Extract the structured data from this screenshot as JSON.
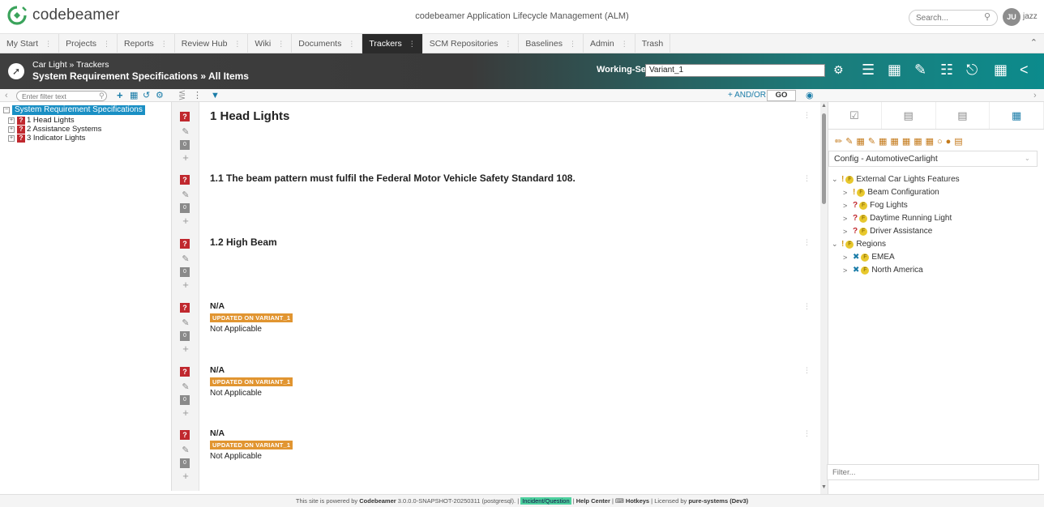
{
  "app": {
    "logo_text": "codebeamer",
    "title": "codebeamer Application Lifecycle Management (ALM)",
    "search_placeholder": "Search...",
    "avatar_initials": "JU",
    "username": "jazz"
  },
  "tabs": [
    {
      "label": "My Start"
    },
    {
      "label": "Projects"
    },
    {
      "label": "Reports"
    },
    {
      "label": "Review Hub"
    },
    {
      "label": "Wiki"
    },
    {
      "label": "Documents"
    },
    {
      "label": "Trackers"
    },
    {
      "label": "SCM Repositories"
    },
    {
      "label": "Baselines"
    },
    {
      "label": "Admin"
    },
    {
      "label": "Trash"
    }
  ],
  "header": {
    "breadcrumb": "Car Light » Trackers",
    "title": "System Requirement Specifications » All Items",
    "working_set_label": "Working-Set:",
    "working_set_value": "Variant_1"
  },
  "toolbar": {
    "filter_placeholder": "Enter filter text",
    "andor_label": "+ AND/OR",
    "go_label": "GO"
  },
  "tree": {
    "root": "System Requirement Specifications",
    "items": [
      {
        "label": "1 Head Lights"
      },
      {
        "label": "2 Assistance Systems"
      },
      {
        "label": "3 Indicator Lights"
      }
    ]
  },
  "items": [
    {
      "title": "1 Head Lights",
      "badge": "0"
    },
    {
      "title": "1.1 The beam pattern must fulfil the Federal Motor Vehicle Safety Standard 108.",
      "badge": "0"
    },
    {
      "title": "1.2 High Beam",
      "badge": "0"
    },
    {
      "title": "N/A",
      "status": "UPDATED ON VARIANT_1",
      "desc": "Not Applicable",
      "badge": "0"
    },
    {
      "title": "N/A",
      "status": "UPDATED ON VARIANT_1",
      "desc": "Not Applicable",
      "badge": "0"
    },
    {
      "title": "N/A",
      "status": "UPDATED ON VARIANT_1",
      "desc": "Not Applicable",
      "badge": "0"
    }
  ],
  "right_panel": {
    "config_select": "Config - AutomotiveCarlight",
    "features": [
      {
        "label": "External Car Lights Features"
      },
      {
        "label": "Beam Configuration"
      },
      {
        "label": "Fog Lights"
      },
      {
        "label": "Daytime Running Light"
      },
      {
        "label": "Driver Assistance"
      },
      {
        "label": "Regions"
      },
      {
        "label": "EMEA"
      },
      {
        "label": "North America"
      }
    ],
    "filter_placeholder": "Filter..."
  },
  "footer": {
    "prefix": "This site is powered by",
    "product": "Codebeamer",
    "version": "3.0.0.0-SNAPSHOT-20250311 (postgresql).",
    "incident": "Incident/Question",
    "help": "Help Center",
    "hotkeys": "Hotkeys",
    "license_prefix": "Licensed by",
    "licensee": "pure-systems (Dev3)"
  },
  "colors": {
    "accent": "#1a7ca8",
    "requirement_red": "#c0282e",
    "status_orange": "#e19531",
    "header_teal": "#0c8b8c"
  }
}
